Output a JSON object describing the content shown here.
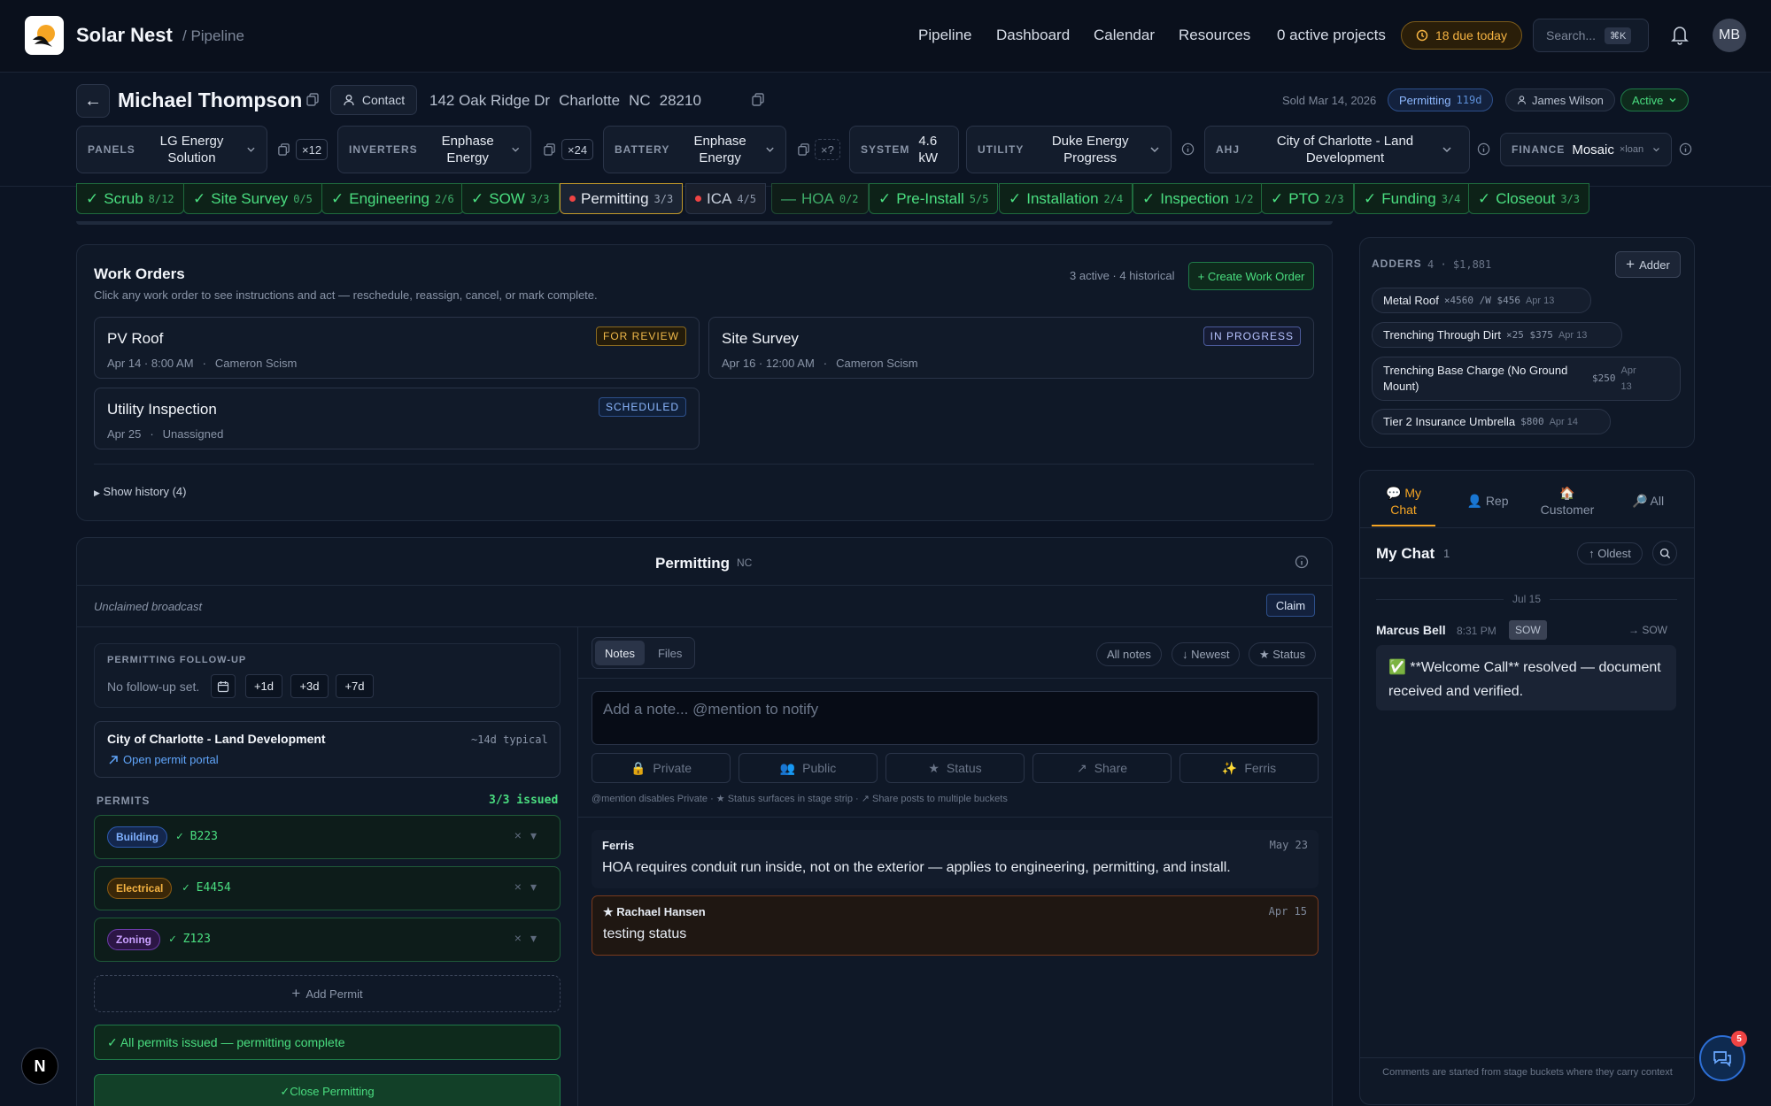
{
  "app": {
    "name": "Solar Nest",
    "crumb": "/ Pipeline"
  },
  "nav": {
    "items": [
      "Pipeline",
      "Dashboard",
      "Calendar",
      "Resources"
    ],
    "active_projects": "0 active projects",
    "due": "18 due today",
    "search_placeholder": "Search...",
    "search_kbd": "⌘K",
    "avatar": "MB"
  },
  "customer": {
    "back": "←",
    "name": "Michael Thompson",
    "contact_label": "Contact",
    "street": "142 Oak Ridge Dr",
    "city": "Charlotte",
    "state": "NC",
    "zip": "28210",
    "sold": "Sold Mar 14, 2026",
    "stage_pill": "Permitting",
    "stage_days": "119d",
    "rep": "James Wilson",
    "status": "Active"
  },
  "equipment": {
    "panels": {
      "label": "PANELS",
      "value": "LG Energy Solution",
      "qty": "×12"
    },
    "inverters": {
      "label": "INVERTERS",
      "value": "Enphase Energy",
      "qty": "×24"
    },
    "battery": {
      "label": "BATTERY",
      "value": "Enphase Energy",
      "qty": "×?"
    },
    "system": {
      "label": "SYSTEM",
      "value": "4.6 kW"
    },
    "utility": {
      "label": "UTILITY",
      "value": "Duke Energy Progress"
    },
    "ahj": {
      "label": "AHJ",
      "value": "City of Charlotte - Land Development"
    },
    "finance": {
      "label": "FINANCE",
      "value": "Mosaic",
      "type": "×loan"
    }
  },
  "stages": [
    {
      "name": "Scrub",
      "count": "8/12",
      "mark": "✓"
    },
    {
      "name": "Site Survey",
      "count": "0/5",
      "mark": "✓"
    },
    {
      "name": "Engineering",
      "count": "2/6",
      "mark": "✓"
    },
    {
      "name": "SOW",
      "count": "3/3",
      "mark": "✓"
    },
    {
      "name": "Permitting",
      "count": "3/3",
      "mark": ""
    },
    {
      "name": "ICA",
      "count": "4/5",
      "mark": ""
    },
    {
      "name": "HOA",
      "count": "0/2",
      "mark": "—"
    },
    {
      "name": "Pre-Install",
      "count": "5/5",
      "mark": "✓"
    },
    {
      "name": "Installation",
      "count": "2/4",
      "mark": "✓"
    },
    {
      "name": "Inspection",
      "count": "1/2",
      "mark": "✓"
    },
    {
      "name": "PTO",
      "count": "2/3",
      "mark": "✓"
    },
    {
      "name": "Funding",
      "count": "3/4",
      "mark": "✓"
    },
    {
      "name": "Closeout",
      "count": "3/3",
      "mark": "✓"
    }
  ],
  "work_orders": {
    "title": "Work Orders",
    "subtitle": "Click any work order to see instructions and act — reschedule, reassign, cancel, or mark complete.",
    "count": "3 active · 4 historical",
    "create": "+ Create Work Order",
    "items": [
      {
        "title": "PV Roof",
        "when": "Apr 14 · 8:00 AM",
        "who": "Cameron Scism",
        "status": "FOR REVIEW"
      },
      {
        "title": "Site Survey",
        "when": "Apr 16 · 12:00 AM",
        "who": "Cameron Scism",
        "status": "IN PROGRESS"
      },
      {
        "title": "Utility Inspection",
        "when": "Apr 25",
        "who": "Unassigned",
        "status": "SCHEDULED"
      }
    ],
    "history": "Show history (4)"
  },
  "permitting": {
    "title": "Permitting",
    "state": "NC",
    "broadcast": "Unclaimed broadcast",
    "claim": "Claim",
    "followup_label": "PERMITTING FOLLOW-UP",
    "followup_text": "No follow-up set.",
    "followup_buttons": [
      "+1d",
      "+3d",
      "+7d"
    ],
    "ahj_name": "City of Charlotte - Land Development",
    "ahj_typical": "~14d typical",
    "portal": "Open permit portal",
    "permits_label": "PERMITS",
    "permits_count": "3/3 issued",
    "permits": [
      {
        "type": "Building",
        "number": "✓ B223",
        "color": "#3b82f6"
      },
      {
        "type": "Electrical",
        "number": "✓ E4454",
        "color": "#f59e0b"
      },
      {
        "type": "Zoning",
        "number": "✓ Z123",
        "color": "#a855f7"
      }
    ],
    "add_permit": "Add Permit",
    "all_issued": "✓ All permits issued — permitting complete",
    "close": "✓Close Permitting"
  },
  "notes": {
    "tabs": [
      "Notes",
      "Files"
    ],
    "filters": [
      "All notes",
      "↓ Newest",
      "★ Status"
    ],
    "placeholder": "Add a note... @mention to notify",
    "actions": [
      "Private",
      "Public",
      "Status",
      "Share",
      "Ferris"
    ],
    "hint": "@mention disables Private · ★ Status surfaces in stage strip · ↗ Share posts to multiple buckets",
    "items": [
      {
        "author": "Ferris",
        "date": "May 23",
        "body": "HOA requires conduit run inside, not on the exterior — applies to engineering, permitting, and install."
      },
      {
        "author": "★ Rachael Hansen",
        "date": "Apr 15",
        "body": "testing status"
      }
    ]
  },
  "adders": {
    "label": "ADDERS",
    "summary": "4 · $1,881",
    "button": "Adder",
    "items": [
      {
        "name": "Metal Roof",
        "spec": "×4560 /W $456",
        "date": "Apr 13"
      },
      {
        "name": "Trenching Through Dirt",
        "spec": "×25 $375",
        "date": "Apr 13"
      },
      {
        "name": "Trenching Base Charge (No Ground Mount)",
        "spec": "$250",
        "date": "Apr 13"
      },
      {
        "name": "Tier 2 Insurance Umbrella",
        "spec": "$800",
        "date": "Apr 14"
      }
    ]
  },
  "chat": {
    "tabs": [
      {
        "icon": "💬",
        "label": "My Chat"
      },
      {
        "icon": "👤",
        "label": "Rep"
      },
      {
        "icon": "🏠",
        "label": "Customer"
      },
      {
        "icon": "🔎",
        "label": "All"
      }
    ],
    "title": "My Chat",
    "count": "1",
    "sort": "↑ Oldest",
    "date": "Jul 15",
    "message": {
      "author": "Marcus Bell",
      "time": "8:31 PM",
      "tag": "SOW",
      "to": "→ SOW",
      "body": "✅ **Welcome Call** resolved — document received and verified."
    },
    "footer": "Comments are started from stage buckets where they carry context"
  },
  "fab_badge": "5",
  "dev_logo": "N",
  "colors": {
    "accent_green": "#4ade80",
    "accent_amber": "#f5a524",
    "bg": "#0c1423"
  }
}
